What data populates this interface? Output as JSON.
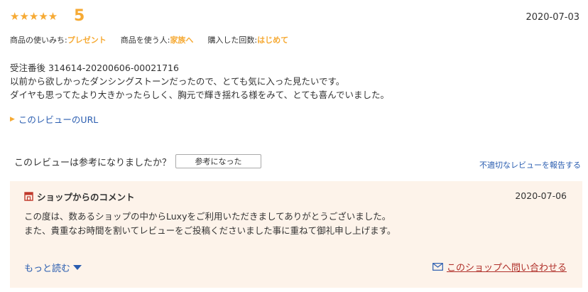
{
  "review": {
    "stars": "★★★★★",
    "score": "5",
    "date": "2020-07-03",
    "meta": [
      {
        "label": "商品の使いみち:",
        "value": "プレゼント"
      },
      {
        "label": "商品を使う人:",
        "value": "家族へ"
      },
      {
        "label": "購入した回数:",
        "value": "はじめて"
      }
    ],
    "lines": [
      "受注番後 314614-20200606-00021716",
      "以前から欲しかったダンシングストーンだったので、とても気に入った見たいです。",
      "ダイヤも思ってたより大きかったらしく、胸元で輝き揺れる様をみて、とても喜んでいました。"
    ],
    "url_link": "このレビューのURL"
  },
  "helpful": {
    "question": "このレビューは参考になりましたか？",
    "button": "参考になった",
    "report": "不適切なレビューを報告する"
  },
  "shop": {
    "title": "ショップからのコメント",
    "date": "2020-07-06",
    "lines": [
      "この度は、数あるショップの中からLuxyをご利用いただきましてありがとうございました。",
      "また、貴重なお時間を割いてレビューをご投稿くださいました事に重ねて御礼申し上げます。"
    ],
    "more": "もっと読む",
    "contact": "このショップへ問い合わせる"
  },
  "colors": {
    "accent": "#f6aa34",
    "link": "#2a5db0",
    "contact": "#b0302a",
    "shop_bg": "#fdf3ea"
  }
}
